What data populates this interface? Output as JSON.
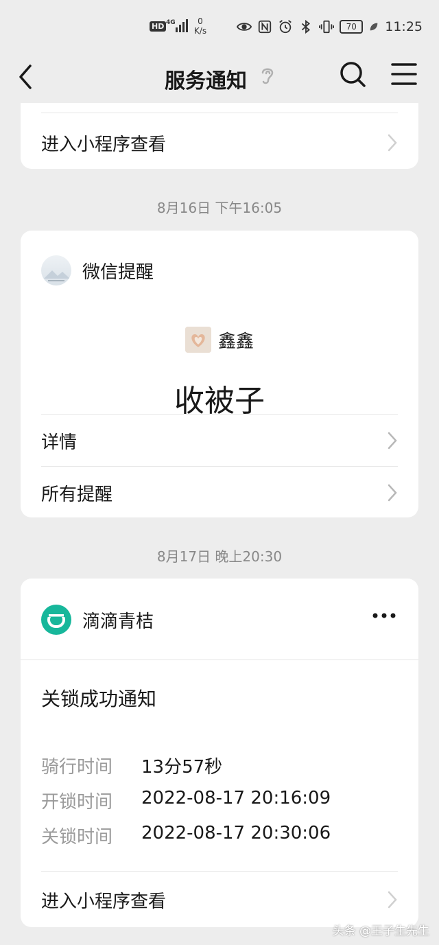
{
  "status_bar": {
    "hd": "HD",
    "network": "4G",
    "speed_value": "0",
    "speed_unit": "K/s",
    "battery": "70",
    "time": "11:25"
  },
  "nav": {
    "title": "服务通知"
  },
  "card_top": {
    "link_label": "进入小程序查看"
  },
  "timestamp_1": "8月16日 下午16:05",
  "card_reminder": {
    "app_name": "微信提醒",
    "sender_name": "鑫鑫",
    "message": "收被子",
    "links": [
      {
        "label": "详情"
      },
      {
        "label": "所有提醒"
      }
    ]
  },
  "timestamp_2": "8月17日 晚上20:30",
  "card_didi": {
    "app_name": "滴滴青桔",
    "notice_title": "关锁成功通知",
    "fields": [
      {
        "key": "骑行时间",
        "value": "13分57秒"
      },
      {
        "key": "开锁时间",
        "value": "2022-08-17 20:16:09"
      },
      {
        "key": "关锁时间",
        "value": "2022-08-17 20:30:06"
      }
    ],
    "link_label": "进入小程序查看"
  },
  "watermark": "头条 @王子生先生",
  "colors": {
    "background": "#ededed",
    "card": "#ffffff",
    "didi_brand": "#17b79b",
    "muted_text": "#9a9a9a"
  }
}
